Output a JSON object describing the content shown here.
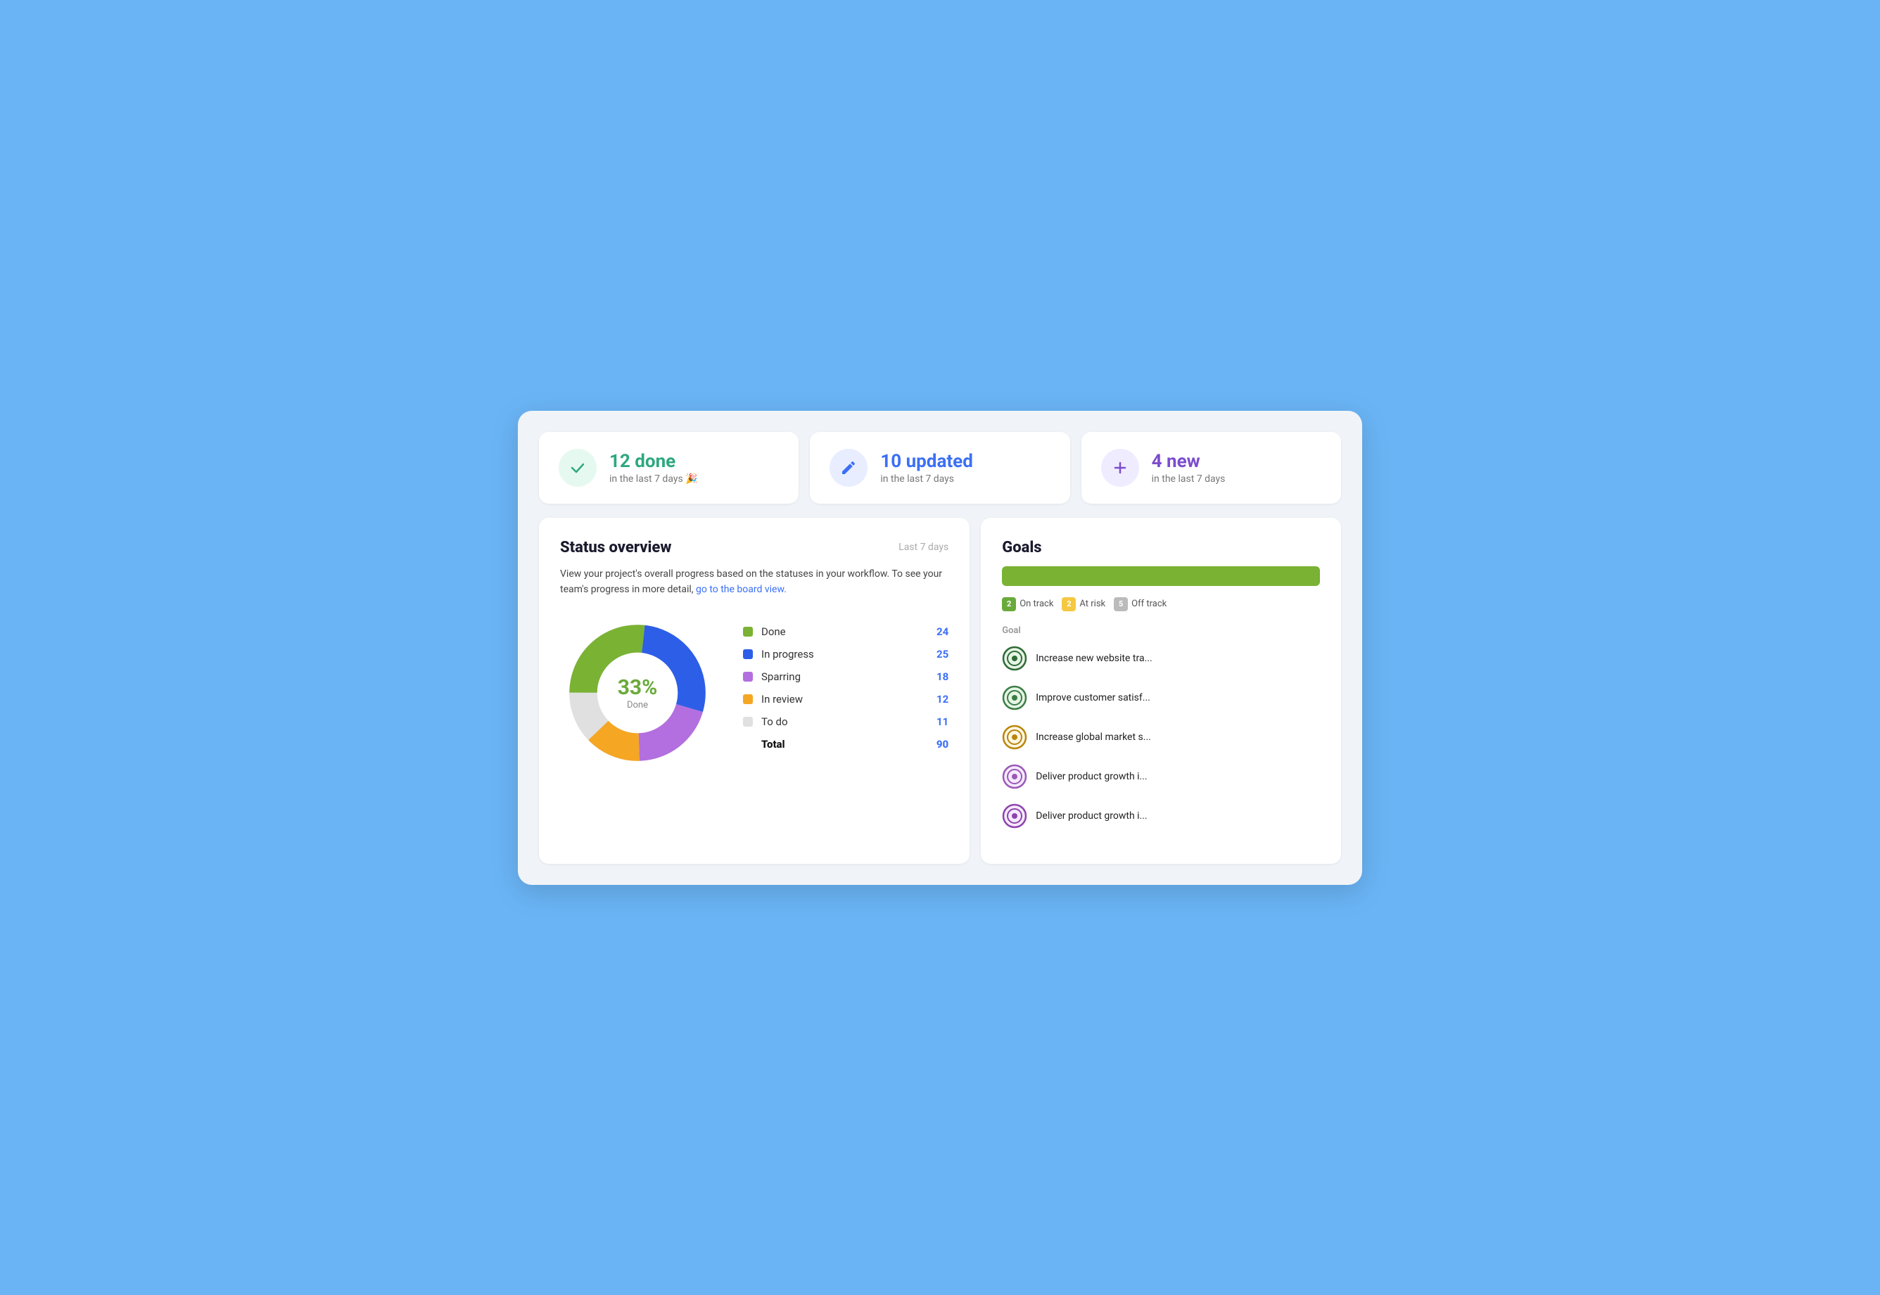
{
  "stats": [
    {
      "id": "done",
      "icon_char": "✓",
      "icon_color": "green",
      "title": "12 done",
      "subtitle": "in the last 7 days 🎉",
      "title_color": "green"
    },
    {
      "id": "updated",
      "icon_char": "✏",
      "icon_color": "blue",
      "title": "10 updated",
      "subtitle": "in the last 7 days",
      "title_color": "blue"
    },
    {
      "id": "new",
      "icon_char": "+",
      "icon_color": "purple",
      "title": "4 new",
      "subtitle": "in the last 7 days",
      "title_color": "purple"
    }
  ],
  "status_overview": {
    "title": "Status overview",
    "period_label": "Last 7 days",
    "description_part1": "View your project's overall progress based on the statuses in your workflow. To see your team's progress in more detail, ",
    "link_text": "go to the board view.",
    "description_part2": "",
    "donut": {
      "percentage": "33%",
      "center_label": "Done",
      "segments": [
        {
          "label": "Done",
          "color": "#7ab234",
          "value": 24,
          "percent": 26.7
        },
        {
          "label": "In progress",
          "color": "#2d5ee8",
          "value": 25,
          "percent": 27.8
        },
        {
          "label": "Sparring",
          "color": "#b36fdf",
          "value": 18,
          "percent": 20
        },
        {
          "label": "In review",
          "color": "#f5a623",
          "value": 12,
          "percent": 13.3
        },
        {
          "label": "To do",
          "color": "#e0e0e0",
          "value": 11,
          "percent": 12.2
        }
      ],
      "total_label": "Total",
      "total": 90
    }
  },
  "goals": {
    "title": "Goals",
    "progress_bar_color": "#7ab234",
    "tags": [
      {
        "label": "On track",
        "count": "2",
        "color": "green"
      },
      {
        "label": "At risk",
        "count": "2",
        "color": "yellow"
      },
      {
        "label": "Off track",
        "count": "5",
        "color": "gray"
      }
    ],
    "header_label": "Goal",
    "items": [
      {
        "name": "Increase new website tra...",
        "icon_type": "target-green-dark",
        "ring_color": "#3a7d44",
        "fill_color": "#3a7d44"
      },
      {
        "name": "Improve customer satisf...",
        "icon_type": "target-green",
        "ring_color": "#3a7d44",
        "fill_color": "#3a7d44"
      },
      {
        "name": "Increase global market s...",
        "icon_type": "target-yellow",
        "ring_color": "#c8a020",
        "fill_color": "#c8a020"
      },
      {
        "name": "Deliver product growth i...",
        "icon_type": "target-purple-light",
        "ring_color": "#9b59b6",
        "fill_color": "#9b59b6"
      },
      {
        "name": "Deliver product growth i...",
        "icon_type": "target-purple",
        "ring_color": "#9b59b6",
        "fill_color": "#9b59b6"
      }
    ]
  }
}
